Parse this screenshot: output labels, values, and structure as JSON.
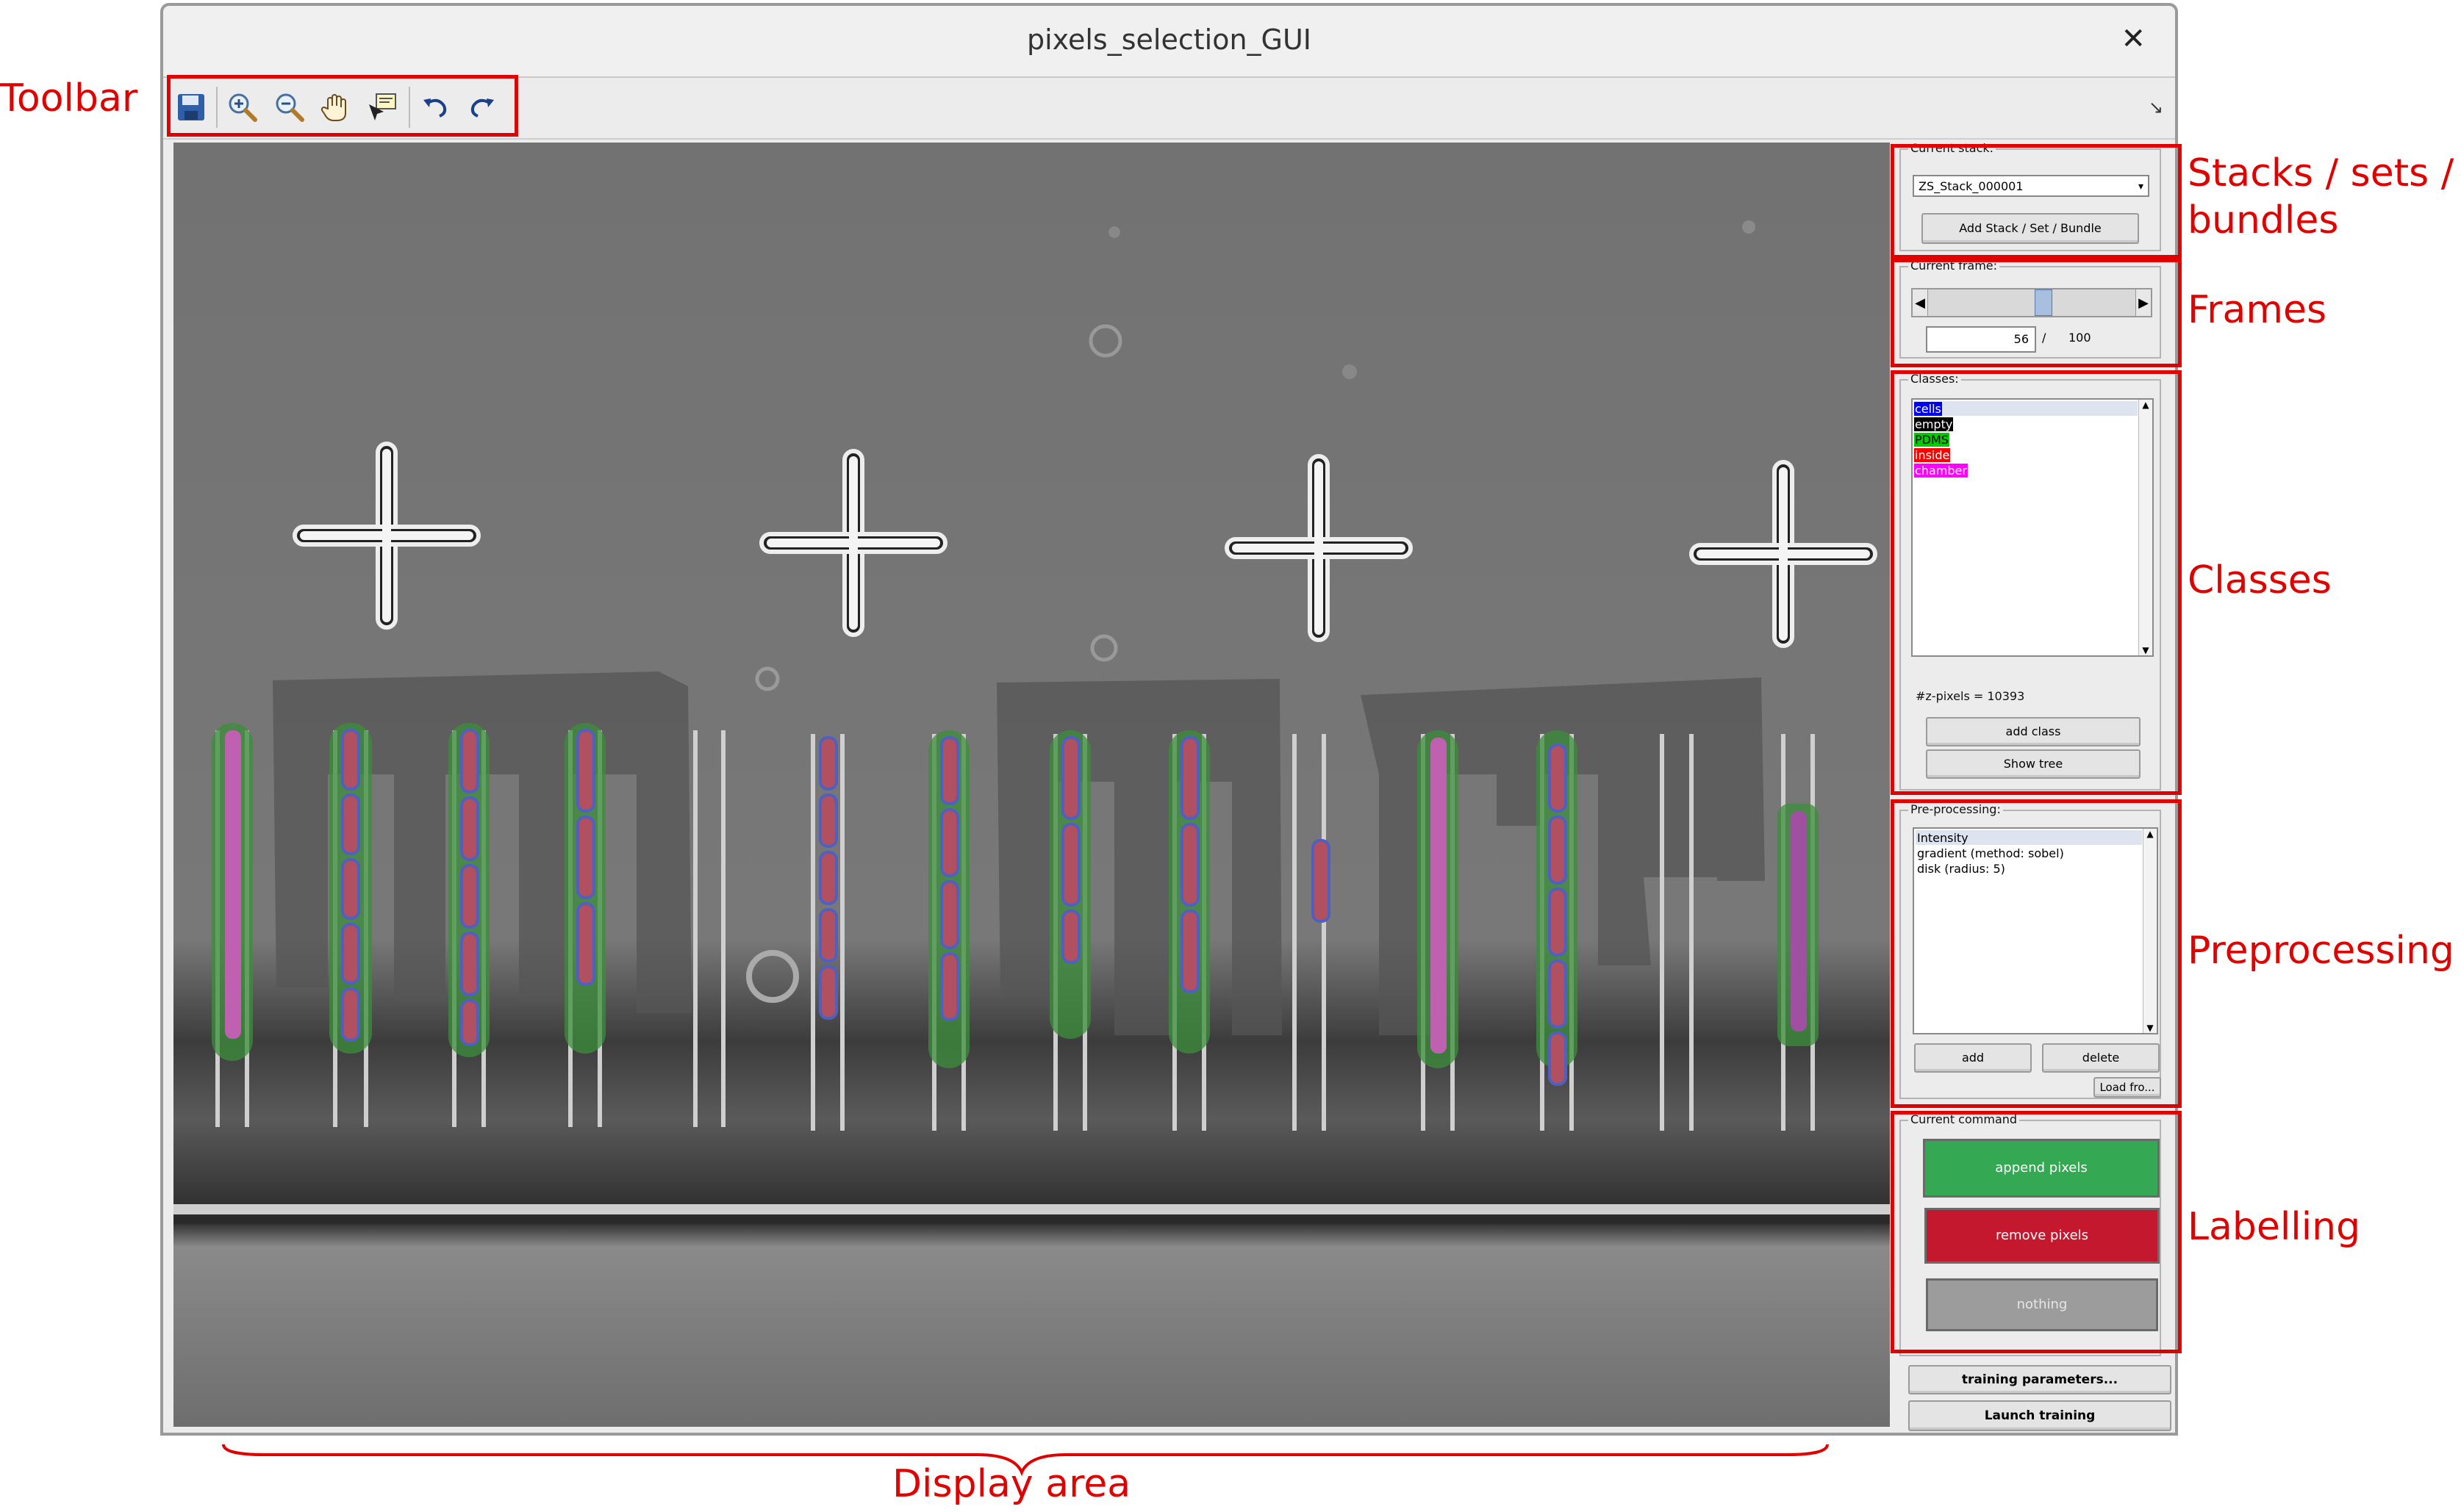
{
  "window": {
    "title": "pixels_selection_GUI",
    "close_glyph": "✕"
  },
  "toolbar": {
    "icons": [
      "save-icon",
      "zoom-in-icon",
      "zoom-out-icon",
      "pan-hand-icon",
      "data-cursor-icon",
      "undo-icon",
      "redo-icon"
    ],
    "dock_glyph": "↘"
  },
  "stacks": {
    "label": "Current stack:",
    "selected": "ZS_Stack_000001",
    "add_button": "Add Stack / Set / Bundle"
  },
  "frames": {
    "label": "Current frame:",
    "current": "56",
    "separator": "/",
    "total": "100",
    "slider_fraction": 0.56
  },
  "classes": {
    "label": "Classes:",
    "items": [
      {
        "name": "cells",
        "bg": "#0000ff",
        "fg": "#ffffff"
      },
      {
        "name": "empty",
        "bg": "#000000",
        "fg": "#ffffff"
      },
      {
        "name": "PDMS",
        "bg": "#00cc00",
        "fg": "#000000"
      },
      {
        "name": "inside",
        "bg": "#ff0000",
        "fg": "#ffffff"
      },
      {
        "name": "chamber",
        "bg": "#ff00ff",
        "fg": "#ffffff"
      }
    ],
    "zpixels": "#z-pixels = 10393",
    "add_button": "add class",
    "tree_button": "Show tree"
  },
  "preprocessing": {
    "label": "Pre-processing:",
    "items": [
      "Intensity",
      "gradient (method: sobel)",
      "disk (radius: 5)"
    ],
    "add_button": "add",
    "delete_button": "delete",
    "load_button": "Load fro..."
  },
  "labelling": {
    "label": "Current command",
    "append_button": "append pixels",
    "remove_button": "remove pixels",
    "nothing_button": "nothing",
    "append_color": "#34a853",
    "remove_color": "#c3182d",
    "nothing_color": "#9c9c9c"
  },
  "training": {
    "params_button": "training parameters...",
    "launch_button": "Launch training"
  },
  "annotations": {
    "toolbar": "Toolbar",
    "stacks_line1": "Stacks / sets /",
    "stacks_line2": "bundles",
    "frames": "Frames",
    "classes": "Classes",
    "preprocessing": "Preprocessing",
    "labelling": "Labelling",
    "display": "Display area",
    "color": "#e00000"
  }
}
